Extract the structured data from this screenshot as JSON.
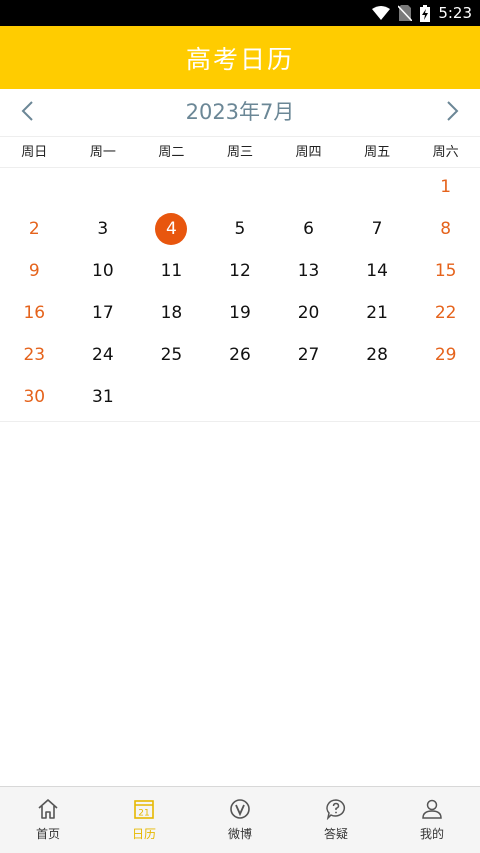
{
  "status_bar": {
    "time": "5:23",
    "icons": [
      "wifi-icon",
      "no-sim-icon",
      "battery-charging-icon"
    ]
  },
  "header": {
    "title": "高考日历"
  },
  "calendar": {
    "month_label": "2023年7月",
    "prev_icon": "chevron-left-icon",
    "next_icon": "chevron-right-icon",
    "weekdays": [
      "周日",
      "周一",
      "周二",
      "周三",
      "周四",
      "周五",
      "周六"
    ],
    "selected_day": "4",
    "weeks": [
      [
        "",
        "",
        "",
        "",
        "",
        "",
        "1"
      ],
      [
        "2",
        "3",
        "4",
        "5",
        "6",
        "7",
        "8"
      ],
      [
        "9",
        "10",
        "11",
        "12",
        "13",
        "14",
        "15"
      ],
      [
        "16",
        "17",
        "18",
        "19",
        "20",
        "21",
        "22"
      ],
      [
        "23",
        "24",
        "25",
        "26",
        "27",
        "28",
        "29"
      ],
      [
        "30",
        "31",
        "",
        "",
        "",
        "",
        ""
      ]
    ]
  },
  "bottom_nav": {
    "items": [
      {
        "label": "首页",
        "icon": "home-icon"
      },
      {
        "label": "日历",
        "icon": "calendar-icon",
        "icon_text": "21",
        "active": true
      },
      {
        "label": "微博",
        "icon": "weibo-icon"
      },
      {
        "label": "答疑",
        "icon": "question-bubble-icon"
      },
      {
        "label": "我的",
        "icon": "user-icon"
      }
    ]
  },
  "colors": {
    "header_bg": "#FFCC00",
    "weekend": "#E5631C",
    "today_bg": "#E8560E",
    "month_label": "#6b8796",
    "nav_active": "#E6B800"
  }
}
